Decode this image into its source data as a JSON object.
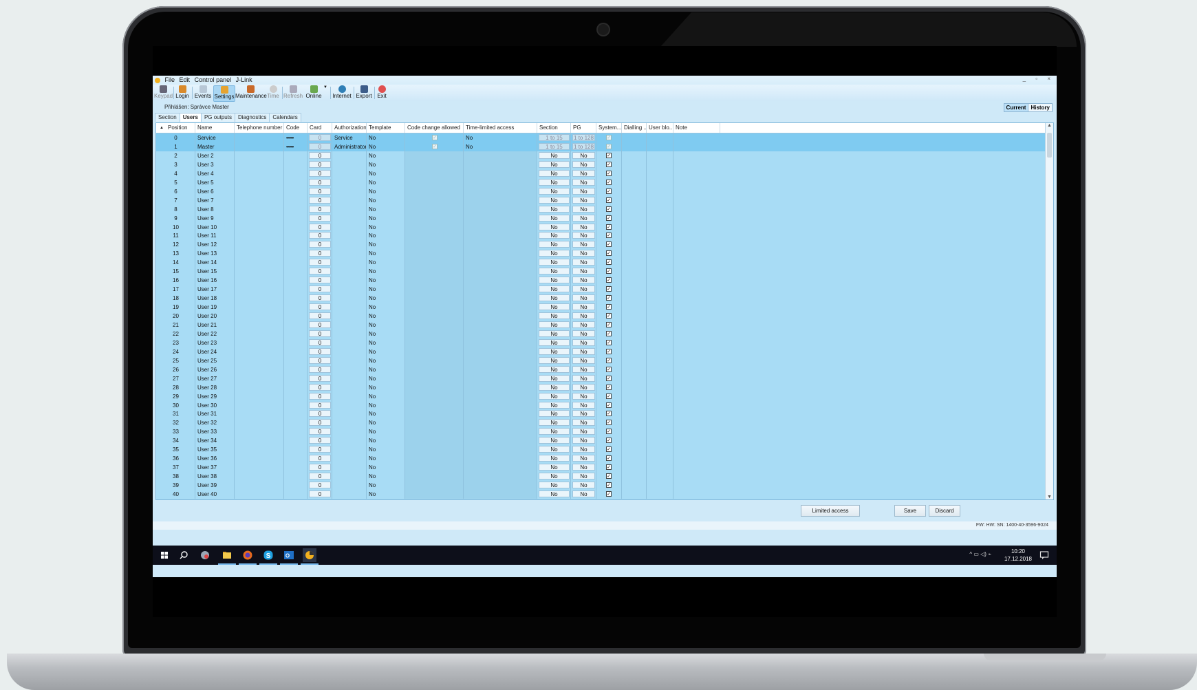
{
  "menu": {
    "items": [
      "File",
      "Edit",
      "Control panel",
      "J-Link"
    ]
  },
  "toolbar": {
    "buttons": [
      {
        "label": "Keypad",
        "icon": "keypad-icon",
        "enabled": false
      },
      {
        "label": "Login",
        "icon": "login-icon",
        "enabled": true
      },
      {
        "label": "Events",
        "icon": "events-icon",
        "enabled": true
      },
      {
        "label": "Settings",
        "icon": "settings-icon",
        "enabled": true,
        "active": true
      },
      {
        "label": "Maintenance",
        "icon": "maintenance-icon",
        "enabled": true
      },
      {
        "label": "Time",
        "icon": "clock-icon",
        "enabled": false
      },
      {
        "label": "Refresh",
        "icon": "refresh-icon",
        "enabled": false
      },
      {
        "label": "Online",
        "icon": "online-icon",
        "enabled": true
      },
      {
        "label": "Internet",
        "icon": "internet-icon",
        "enabled": true
      },
      {
        "label": "Export",
        "icon": "export-icon",
        "enabled": true
      },
      {
        "label": "Exit",
        "icon": "exit-icon",
        "enabled": true
      }
    ]
  },
  "login_status": "Přihlášen: Správce Master",
  "view_toggle": {
    "current": "Current",
    "history": "History"
  },
  "tabs": [
    "Section",
    "Users",
    "PG outputs",
    "Diagnostics",
    "Calendars"
  ],
  "selected_tab": "Users",
  "grid": {
    "columns": [
      "Position",
      "Name",
      "Telephone number",
      "Code",
      "Card",
      "Authorization",
      "Template",
      "Code change allowed",
      "Time-limited access",
      "Section",
      "PG",
      "System...",
      "Dialling ...",
      "User blo...",
      "Note"
    ],
    "rows": [
      {
        "pos": "0",
        "name": "Service",
        "code": "••••",
        "card": "0",
        "auth": "Service",
        "template": "No",
        "code_change": true,
        "time_limited": "No",
        "section": "1 to 15",
        "pg": "1 to 128",
        "system": true,
        "selected": true
      },
      {
        "pos": "1",
        "name": "Master",
        "code": "••••",
        "card": "0",
        "auth": "Administrator",
        "template": "No",
        "code_change": true,
        "time_limited": "No",
        "section": "1 to 15",
        "pg": "1 to 128",
        "system": true,
        "selected": true
      },
      {
        "pos": "2",
        "name": "User 2",
        "card": "0",
        "template": "No",
        "section": "No",
        "pg": "No",
        "system": true
      },
      {
        "pos": "3",
        "name": "User 3",
        "card": "0",
        "template": "No",
        "section": "No",
        "pg": "No",
        "system": true
      },
      {
        "pos": "4",
        "name": "User 4",
        "card": "0",
        "template": "No",
        "section": "No",
        "pg": "No",
        "system": true
      },
      {
        "pos": "5",
        "name": "User 5",
        "card": "0",
        "template": "No",
        "section": "No",
        "pg": "No",
        "system": true
      },
      {
        "pos": "6",
        "name": "User 6",
        "card": "0",
        "template": "No",
        "section": "No",
        "pg": "No",
        "system": true
      },
      {
        "pos": "7",
        "name": "User 7",
        "card": "0",
        "template": "No",
        "section": "No",
        "pg": "No",
        "system": true
      },
      {
        "pos": "8",
        "name": "User 8",
        "card": "0",
        "template": "No",
        "section": "No",
        "pg": "No",
        "system": true
      },
      {
        "pos": "9",
        "name": "User 9",
        "card": "0",
        "template": "No",
        "section": "No",
        "pg": "No",
        "system": true
      },
      {
        "pos": "10",
        "name": "User 10",
        "card": "0",
        "template": "No",
        "section": "No",
        "pg": "No",
        "system": true
      },
      {
        "pos": "11",
        "name": "User 11",
        "card": "0",
        "template": "No",
        "section": "No",
        "pg": "No",
        "system": true
      },
      {
        "pos": "12",
        "name": "User 12",
        "card": "0",
        "template": "No",
        "section": "No",
        "pg": "No",
        "system": true
      },
      {
        "pos": "13",
        "name": "User 13",
        "card": "0",
        "template": "No",
        "section": "No",
        "pg": "No",
        "system": true
      },
      {
        "pos": "14",
        "name": "User 14",
        "card": "0",
        "template": "No",
        "section": "No",
        "pg": "No",
        "system": true
      },
      {
        "pos": "15",
        "name": "User 15",
        "card": "0",
        "template": "No",
        "section": "No",
        "pg": "No",
        "system": true
      },
      {
        "pos": "16",
        "name": "User 16",
        "card": "0",
        "template": "No",
        "section": "No",
        "pg": "No",
        "system": true
      },
      {
        "pos": "17",
        "name": "User 17",
        "card": "0",
        "template": "No",
        "section": "No",
        "pg": "No",
        "system": true
      },
      {
        "pos": "18",
        "name": "User 18",
        "card": "0",
        "template": "No",
        "section": "No",
        "pg": "No",
        "system": true
      },
      {
        "pos": "19",
        "name": "User 19",
        "card": "0",
        "template": "No",
        "section": "No",
        "pg": "No",
        "system": true
      },
      {
        "pos": "20",
        "name": "User 20",
        "card": "0",
        "template": "No",
        "section": "No",
        "pg": "No",
        "system": true
      },
      {
        "pos": "21",
        "name": "User 21",
        "card": "0",
        "template": "No",
        "section": "No",
        "pg": "No",
        "system": true
      },
      {
        "pos": "22",
        "name": "User 22",
        "card": "0",
        "template": "No",
        "section": "No",
        "pg": "No",
        "system": true
      },
      {
        "pos": "23",
        "name": "User 23",
        "card": "0",
        "template": "No",
        "section": "No",
        "pg": "No",
        "system": true
      },
      {
        "pos": "24",
        "name": "User 24",
        "card": "0",
        "template": "No",
        "section": "No",
        "pg": "No",
        "system": true
      },
      {
        "pos": "25",
        "name": "User 25",
        "card": "0",
        "template": "No",
        "section": "No",
        "pg": "No",
        "system": true
      },
      {
        "pos": "26",
        "name": "User 26",
        "card": "0",
        "template": "No",
        "section": "No",
        "pg": "No",
        "system": true
      },
      {
        "pos": "27",
        "name": "User 27",
        "card": "0",
        "template": "No",
        "section": "No",
        "pg": "No",
        "system": true
      },
      {
        "pos": "28",
        "name": "User 28",
        "card": "0",
        "template": "No",
        "section": "No",
        "pg": "No",
        "system": true
      },
      {
        "pos": "29",
        "name": "User 29",
        "card": "0",
        "template": "No",
        "section": "No",
        "pg": "No",
        "system": true
      },
      {
        "pos": "30",
        "name": "User 30",
        "card": "0",
        "template": "No",
        "section": "No",
        "pg": "No",
        "system": true
      },
      {
        "pos": "31",
        "name": "User 31",
        "card": "0",
        "template": "No",
        "section": "No",
        "pg": "No",
        "system": true
      },
      {
        "pos": "32",
        "name": "User 32",
        "card": "0",
        "template": "No",
        "section": "No",
        "pg": "No",
        "system": true
      },
      {
        "pos": "33",
        "name": "User 33",
        "card": "0",
        "template": "No",
        "section": "No",
        "pg": "No",
        "system": true
      },
      {
        "pos": "34",
        "name": "User 34",
        "card": "0",
        "template": "No",
        "section": "No",
        "pg": "No",
        "system": true
      },
      {
        "pos": "35",
        "name": "User 35",
        "card": "0",
        "template": "No",
        "section": "No",
        "pg": "No",
        "system": true
      },
      {
        "pos": "36",
        "name": "User 36",
        "card": "0",
        "template": "No",
        "section": "No",
        "pg": "No",
        "system": true
      },
      {
        "pos": "37",
        "name": "User 37",
        "card": "0",
        "template": "No",
        "section": "No",
        "pg": "No",
        "system": true
      },
      {
        "pos": "38",
        "name": "User 38",
        "card": "0",
        "template": "No",
        "section": "No",
        "pg": "No",
        "system": true
      },
      {
        "pos": "39",
        "name": "User 39",
        "card": "0",
        "template": "No",
        "section": "No",
        "pg": "No",
        "system": true
      },
      {
        "pos": "40",
        "name": "User 40",
        "card": "0",
        "template": "No",
        "section": "No",
        "pg": "No",
        "system": true
      }
    ]
  },
  "buttons": {
    "limited_access": "Limited access",
    "save": "Save",
    "discard": "Discard"
  },
  "status": "FW:  HW:  SN: 1400-40-3596-9024",
  "taskbar": {
    "items": [
      "windows-start-icon",
      "search-icon",
      "app-icon",
      "file-explorer-icon",
      "firefox-icon",
      "skype-icon",
      "outlook-icon",
      "jablotron-icon"
    ],
    "time": "10:20",
    "date": "17.12.2018"
  },
  "colors": {
    "grid_bg": "#a8dcf5",
    "selected_row": "#7fcbf1",
    "toolbar": "#d7edfa",
    "taskbar": "#0d0f1a"
  }
}
